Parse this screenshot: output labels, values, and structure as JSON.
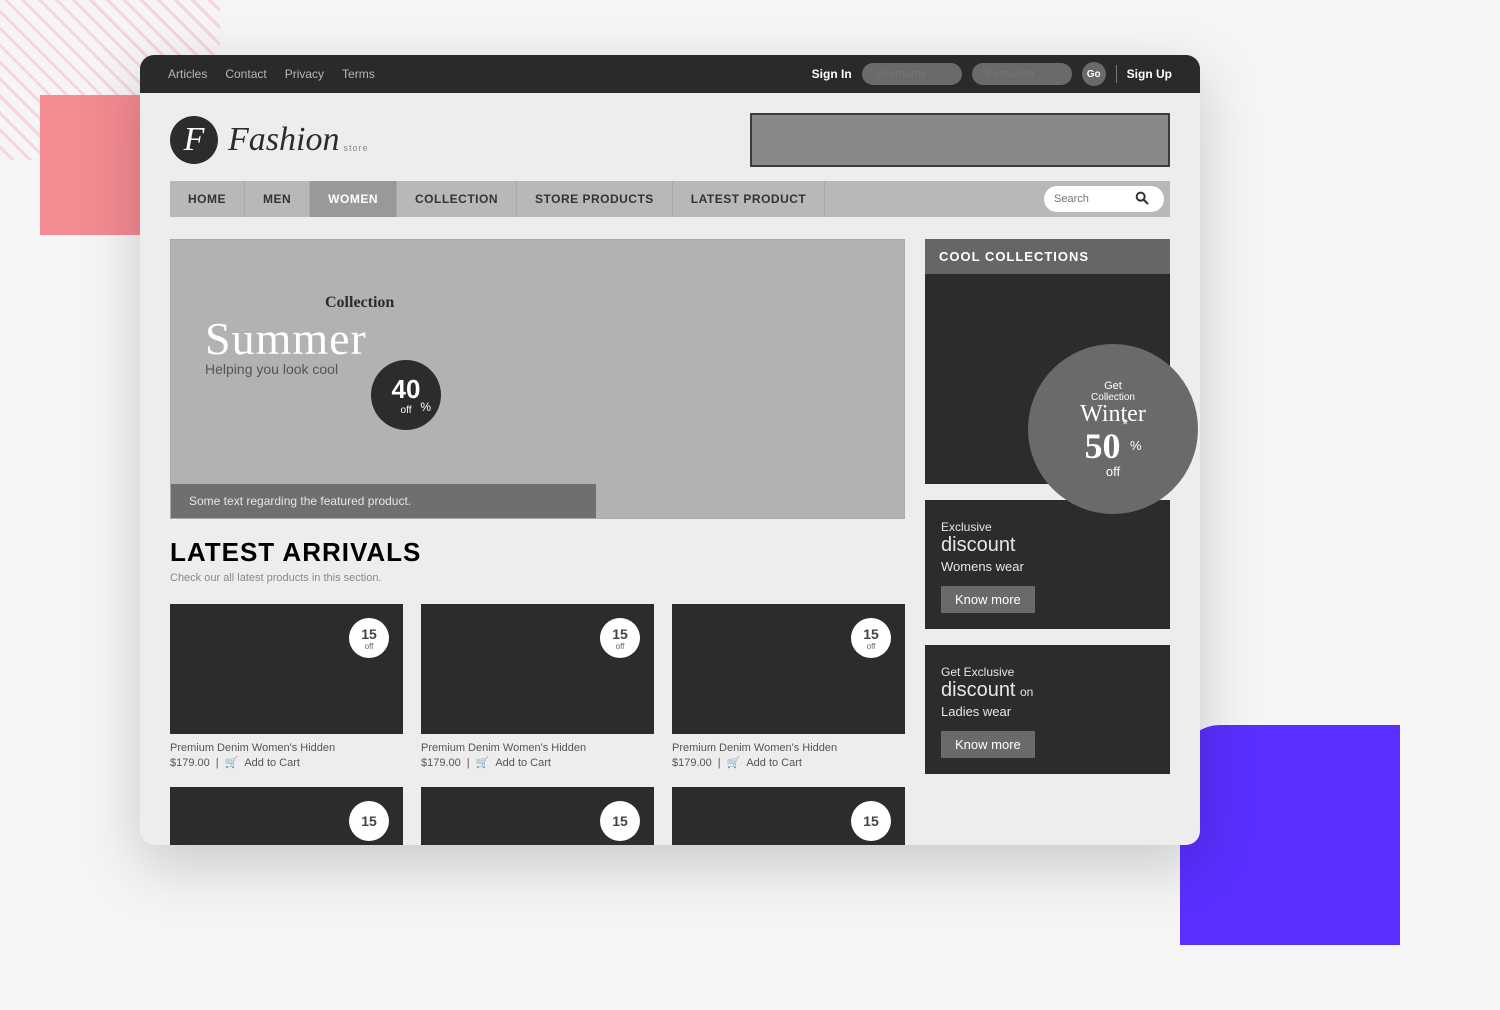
{
  "topbar": {
    "links": [
      "Articles",
      "Contact",
      "Privacy",
      "Terms"
    ],
    "signin_label": "Sign In",
    "username_placeholder": "Username",
    "password_placeholder": "Password",
    "go_label": "Go",
    "signup_label": "Sign Up"
  },
  "brand": {
    "badge_letter": "F",
    "name": "Fashion",
    "sub": "store"
  },
  "nav": {
    "items": [
      "Home",
      "Men",
      "Women",
      "Collection",
      "Store Products",
      "Latest Product"
    ],
    "active_index": 2,
    "search_placeholder": "Search"
  },
  "hero": {
    "collection_label": "Collection",
    "title": "Summer",
    "tagline": "Helping you look cool",
    "badge_number": "40",
    "badge_off": "off",
    "badge_pct": "%",
    "caption": "Some text regarding the featured product."
  },
  "arrivals": {
    "title": "Latest Arrivals",
    "subtitle": "Check our all latest products in this section.",
    "discount": "15",
    "discount_unit": "%",
    "discount_off": "off",
    "products": [
      {
        "name": "Premium Denim Women's Hidden",
        "price": "$179.00",
        "cart": "Add to Cart"
      },
      {
        "name": "Premium Denim Women's Hidden",
        "price": "$179.00",
        "cart": "Add to Cart"
      },
      {
        "name": "Premium Denim Women's Hidden",
        "price": "$179.00",
        "cart": "Add to Cart"
      },
      {
        "name": "",
        "price": "",
        "cart": ""
      },
      {
        "name": "",
        "price": "",
        "cart": ""
      },
      {
        "name": "",
        "price": "",
        "cart": ""
      }
    ]
  },
  "sidebar": {
    "cool_title": "Cool Collections",
    "winter": {
      "get": "Get",
      "collection": "Collection",
      "name": "Winter",
      "value": "50",
      "star": "*",
      "pct": "%",
      "off": "off"
    },
    "promo1": {
      "line1": "Exclusive",
      "line2": "discount",
      "line3": "Womens wear",
      "button": "Know more"
    },
    "promo2": {
      "line1": "Get Exclusive",
      "line2": "discount",
      "line2_suffix": "on",
      "line3": "Ladies wear",
      "button": "Know more"
    }
  }
}
